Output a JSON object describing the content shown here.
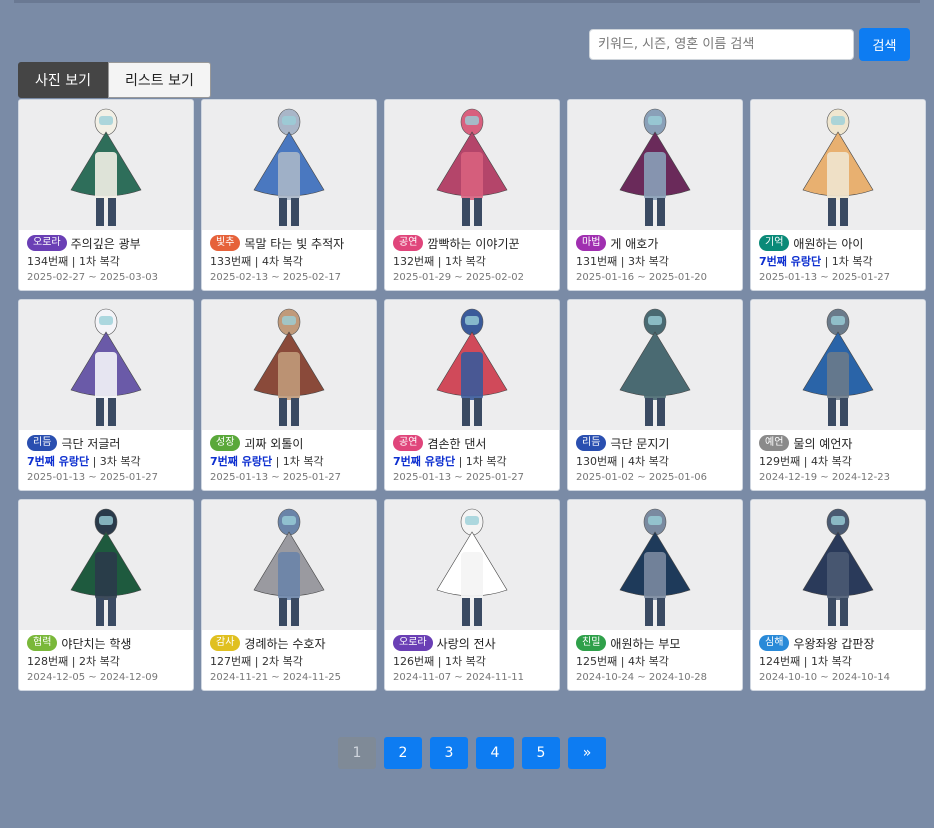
{
  "search": {
    "placeholder": "키워드, 시즌, 영혼 이름 검색",
    "value": "",
    "button_label": "검색"
  },
  "view_tabs": [
    {
      "label": "사진 보기",
      "active": true
    },
    {
      "label": "리스트 보기",
      "active": false
    }
  ],
  "cards": [
    {
      "badge": "오로라",
      "badge_color": "#6a3fb5",
      "name": "주의깊은 광부",
      "number": "134번째",
      "rerun": "1차 복각",
      "troupe": "",
      "date": "2025-02-27 ~ 2025-03-03",
      "icon": "spirit-figure-icon",
      "cape": "#2e6e5a",
      "body": "#f2f0e6"
    },
    {
      "badge": "빛추",
      "badge_color": "#e6623a",
      "name": "목말 타는 빛 추적자",
      "number": "133번째",
      "rerun": "4차 복각",
      "troupe": "",
      "date": "2025-02-13 ~ 2025-02-17",
      "icon": "spirit-figure-icon",
      "cape": "#4a78c0",
      "body": "#a9b6c8"
    },
    {
      "badge": "공연",
      "badge_color": "#e0457b",
      "name": "깜빡하는 이야기꾼",
      "number": "132번째",
      "rerun": "1차 복각",
      "troupe": "",
      "date": "2025-01-29 ~ 2025-02-02",
      "icon": "spirit-figure-icon",
      "cape": "#b4456a",
      "body": "#d8607e"
    },
    {
      "badge": "마법",
      "badge_color": "#a02fb0",
      "name": "게 애호가",
      "number": "131번째",
      "rerun": "3차 복각",
      "troupe": "",
      "date": "2025-01-16 ~ 2025-01-20",
      "icon": "spirit-figure-icon",
      "cape": "#6a2a5a",
      "body": "#8aa0b8"
    },
    {
      "badge": "기억",
      "badge_color": "#0a8a78",
      "name": "애원하는 아이",
      "number": "",
      "rerun": "1차 복각",
      "troupe": "7번째 유랑단",
      "date": "2025-01-13 ~ 2025-01-27",
      "icon": "spirit-figure-icon",
      "cape": "#e8b070",
      "body": "#efe6cf"
    },
    {
      "badge": "리듬",
      "badge_color": "#2a4fb0",
      "name": "극단 저글러",
      "number": "",
      "rerun": "3차 복각",
      "troupe": "7번째 유랑단",
      "date": "2025-01-13 ~ 2025-01-27",
      "icon": "spirit-figure-icon",
      "cape": "#6a5aa8",
      "body": "#f4f4f8"
    },
    {
      "badge": "성장",
      "badge_color": "#5aa83a",
      "name": "괴짜 외톨이",
      "number": "",
      "rerun": "1차 복각",
      "troupe": "7번째 유랑단",
      "date": "2025-01-13 ~ 2025-01-27",
      "icon": "spirit-figure-icon",
      "cape": "#8a4a3a",
      "body": "#c09a7a"
    },
    {
      "badge": "공연",
      "badge_color": "#e0457b",
      "name": "겸손한 댄서",
      "number": "",
      "rerun": "1차 복각",
      "troupe": "7번째 유랑단",
      "date": "2025-01-13 ~ 2025-01-27",
      "icon": "spirit-figure-icon",
      "cape": "#d04a5a",
      "body": "#3a5a9a"
    },
    {
      "badge": "리듬",
      "badge_color": "#2a4fb0",
      "name": "극단 문지기",
      "number": "130번째",
      "rerun": "4차 복각",
      "troupe": "",
      "date": "2025-01-02 ~ 2025-01-06",
      "icon": "spirit-figure-icon",
      "cape": "#4a6a72",
      "body": "#4a6a72"
    },
    {
      "badge": "예언",
      "badge_color": "#8a8a8a",
      "name": "물의 예언자",
      "number": "129번째",
      "rerun": "4차 복각",
      "troupe": "",
      "date": "2024-12-19 ~ 2024-12-23",
      "icon": "spirit-figure-icon",
      "cape": "#2a64a8",
      "body": "#6a7a8a"
    },
    {
      "badge": "협력",
      "badge_color": "#7ab83a",
      "name": "야단치는 학생",
      "number": "128번째",
      "rerun": "2차 복각",
      "troupe": "",
      "date": "2024-12-05 ~ 2024-12-09",
      "icon": "spirit-figure-icon",
      "cape": "#1e5a3e",
      "body": "#2a3a4a"
    },
    {
      "badge": "감사",
      "badge_color": "#e0c020",
      "name": "경례하는 수호자",
      "number": "127번째",
      "rerun": "2차 복각",
      "troupe": "",
      "date": "2024-11-21 ~ 2024-11-25",
      "icon": "spirit-figure-icon",
      "cape": "#9a9aa0",
      "body": "#6a84a8"
    },
    {
      "badge": "오로라",
      "badge_color": "#6a3fb5",
      "name": "사랑의 전사",
      "number": "126번째",
      "rerun": "1차 복각",
      "troupe": "",
      "date": "2024-11-07 ~ 2024-11-11",
      "icon": "spirit-figure-icon",
      "cape": "#ffffff",
      "body": "#f4f4f4"
    },
    {
      "badge": "친밀",
      "badge_color": "#2fa04a",
      "name": "애원하는 부모",
      "number": "125번째",
      "rerun": "4차 복각",
      "troupe": "",
      "date": "2024-10-24 ~ 2024-10-28",
      "icon": "spirit-figure-icon",
      "cape": "#1e3a5a",
      "body": "#7a8aa0"
    },
    {
      "badge": "심해",
      "badge_color": "#2a8ad8",
      "name": "우왕좌왕 갑판장",
      "number": "124번째",
      "rerun": "1차 복각",
      "troupe": "",
      "date": "2024-10-10 ~ 2024-10-14",
      "icon": "spirit-figure-icon",
      "cape": "#2a3a5a",
      "body": "#4a5a72"
    }
  ],
  "pagination": {
    "pages": [
      "1",
      "2",
      "3",
      "4",
      "5"
    ],
    "current": "1",
    "next_label": "»"
  }
}
